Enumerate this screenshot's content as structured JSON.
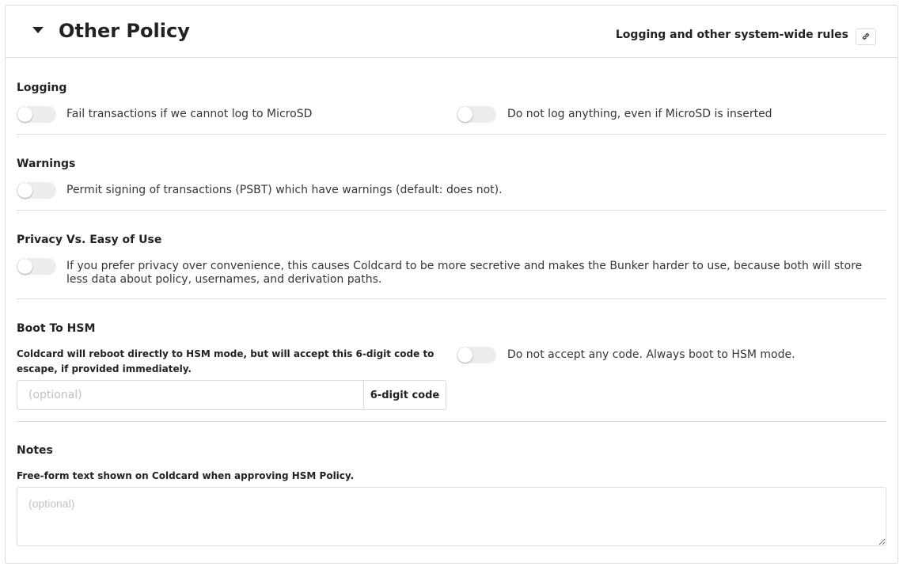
{
  "header": {
    "title": "Other Policy",
    "subtitle": "Logging and other system-wide rules",
    "permalink_icon": "link-icon",
    "collapse_icon": "caret-down-icon"
  },
  "logging": {
    "title": "Logging",
    "fail_if_no_log": {
      "label": "Fail transactions if we cannot log to MicroSD",
      "checked": false
    },
    "never_log": {
      "label": "Do not log anything, even if MicroSD is inserted",
      "checked": false
    }
  },
  "warnings": {
    "title": "Warnings",
    "permit_warnings": {
      "label": "Permit signing of transactions (PSBT) which have warnings (default: does not).",
      "checked": false
    }
  },
  "privacy": {
    "title": "Privacy Vs. Easy of Use",
    "prefer_privacy": {
      "label": "If you prefer privacy over convenience, this causes Coldcard to be more secretive and makes the Bunker harder to use, because both will store less data about policy, usernames, and derivation paths.",
      "checked": false
    }
  },
  "boot_to_hsm": {
    "title": "Boot To HSM",
    "help": "Coldcard will reboot directly to HSM mode, but will accept this 6-digit code to escape, if provided immediately.",
    "code_placeholder": "(optional)",
    "code_value": "",
    "code_addon": "6-digit code",
    "no_code": {
      "label": "Do not accept any code. Always boot to HSM mode.",
      "checked": false
    }
  },
  "notes": {
    "title": "Notes",
    "help": "Free-form text shown on Coldcard when approving HSM Policy.",
    "placeholder": "(optional)",
    "value": ""
  },
  "colors": {
    "border": "#dbdbdb",
    "text": "#363636",
    "heading": "#222222",
    "switch_off": "#ededed",
    "placeholder": "#c2c2c2"
  }
}
